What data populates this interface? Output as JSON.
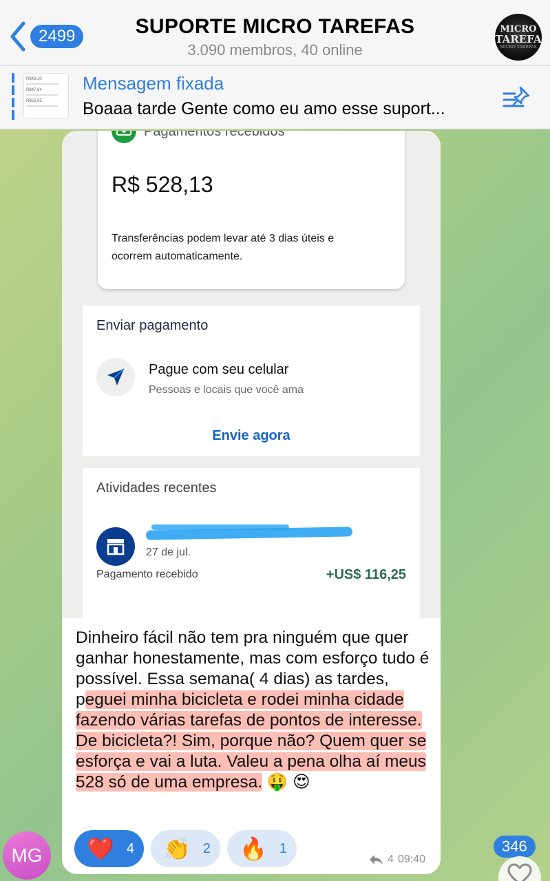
{
  "header": {
    "back_badge": "2499",
    "title": "SUPORTE MICRO TAREFAS",
    "subtitle": "3.090 membros, 40 online",
    "avatar_line1": "MICRO",
    "avatar_line2": "TAREFA",
    "avatar_line3": "MICRO TAREFAS"
  },
  "pinned": {
    "label": "Mensagem fixada",
    "text": "Boaaa tarde Gente como eu amo esse suport...",
    "thumb_lines": [
      "R$43.10",
      "R$47.84",
      "R$55.55"
    ]
  },
  "screenshot": {
    "pay_title": "Pagamentos recebidos",
    "pay_amount": "R$ 528,13",
    "pay_note": "Transferências podem levar até 3 dias úteis e ocorrem automaticamente.",
    "send_title": "Enviar pagamento",
    "send_line1": "Pague com seu celular",
    "send_line2": "Pessoas e locais que você ama",
    "send_link": "Envie agora",
    "activity_title": "Atividades recentes",
    "activity_date": "27 de jul.",
    "activity_status": "Pagamento recebido",
    "activity_amount": "+US$ 116,25"
  },
  "message": {
    "part1": "Dinheiro fácil não tem pra ninguém que quer ganhar honestamente, mas com esforço tudo é possível. Essa semana( 4 dias) as tardes, p",
    "highlight": "eguei minha bicicleta e rodei minha cidade fazendo várias tarefas de pontos de interesse. De bicicleta?! Sim, porque não? Quem quer se esforça e vai a luta. Valeu a pena olha aí meus 528 só de uma empresa.",
    "emojis": "🤑 😍",
    "forward_count": "4",
    "time": "09:40"
  },
  "reactions": [
    {
      "emoji": "❤️",
      "count": "4",
      "active": true
    },
    {
      "emoji": "👏",
      "count": "2",
      "active": false
    },
    {
      "emoji": "🔥",
      "count": "1",
      "active": false
    }
  ],
  "sender_avatar": "MG",
  "unread_badge": "346",
  "colors": {
    "accent": "#2f7fe0",
    "highlight": "#fa8778",
    "paypal_link": "#1466c6",
    "amount_green": "#2a6b4f"
  }
}
